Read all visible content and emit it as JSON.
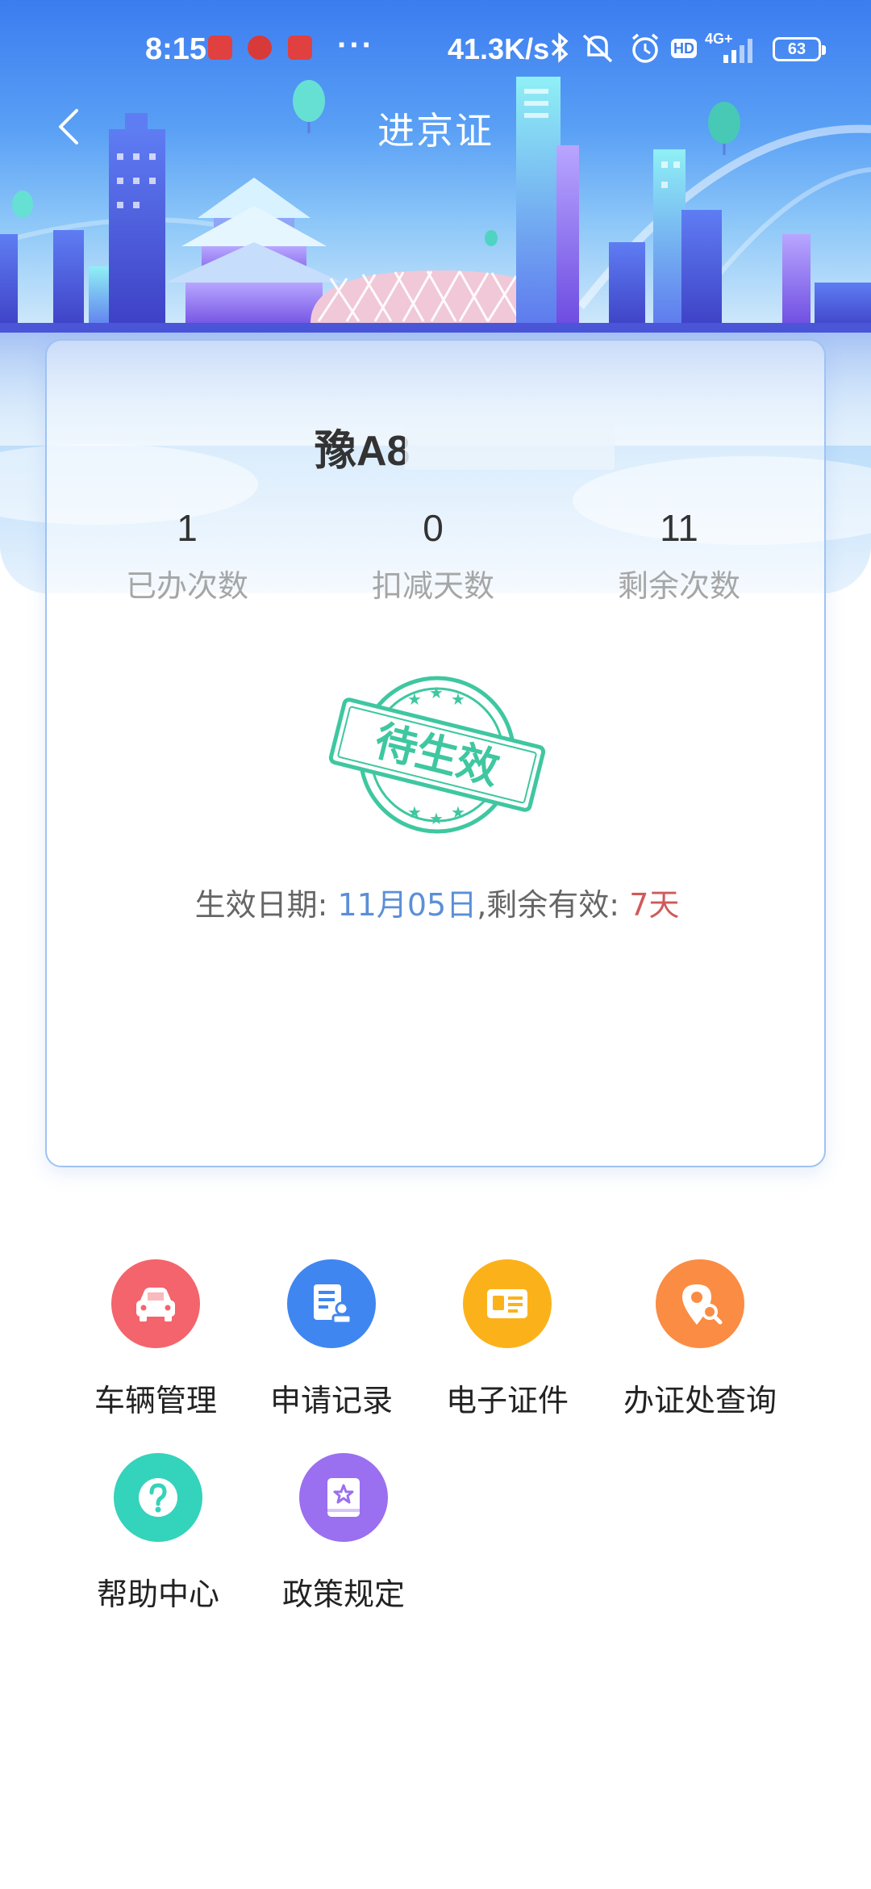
{
  "status_bar": {
    "time": "8:15",
    "more": "···",
    "network_speed": "41.3K/s",
    "network_type": "4G+",
    "hd_badge": "HD",
    "battery": "63"
  },
  "header": {
    "title": "进京证"
  },
  "permit_card": {
    "plate": "豫A8",
    "stats": [
      {
        "value": "1",
        "label": "已办次数"
      },
      {
        "value": "0",
        "label": "扣减天数"
      },
      {
        "value": "11",
        "label": "剩余次数"
      }
    ],
    "stamp_text": "待生效",
    "effective_label": "生效日期: ",
    "effective_date": "11月05日",
    "remaining_label": ",剩余有效: ",
    "remaining_days": "7天"
  },
  "functions": [
    {
      "label": "车辆管理",
      "icon": "car-icon",
      "color": "#f4646c"
    },
    {
      "label": "申请记录",
      "icon": "record-icon",
      "color": "#3f86f0"
    },
    {
      "label": "电子证件",
      "icon": "id-card-icon",
      "color": "#fbb21a"
    },
    {
      "label": "办证处查询",
      "icon": "location-search-icon",
      "color": "#fb8c43"
    },
    {
      "label": "帮助中心",
      "icon": "help-icon",
      "color": "#34d3bb"
    },
    {
      "label": "政策规定",
      "icon": "policy-book-icon",
      "color": "#9a6ff0"
    }
  ]
}
